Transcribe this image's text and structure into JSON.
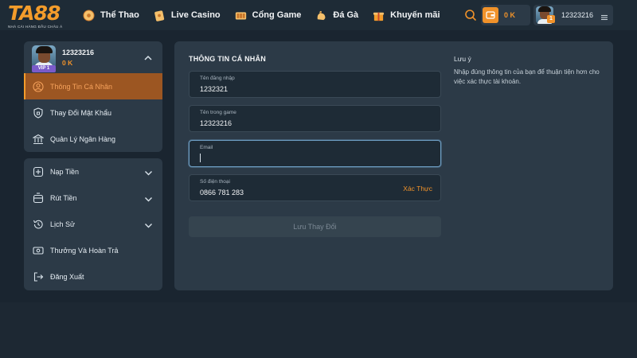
{
  "header": {
    "logo": {
      "text": "TA88",
      "tagline": "NHÀ CÁI HÀNG ĐẦU CHÂU Á"
    },
    "nav": [
      {
        "label": "Thể Thao",
        "icon": "soccer-ball-icon"
      },
      {
        "label": "Live Casino",
        "icon": "playing-card-icon"
      },
      {
        "label": "Cổng Game",
        "icon": "slot-machine-icon"
      },
      {
        "label": "Đá Gà",
        "icon": "rooster-icon"
      },
      {
        "label": "Khuyến mãi",
        "icon": "gift-icon"
      }
    ],
    "balance": "0 K",
    "username": "12323216",
    "user_level": "1"
  },
  "sidebar": {
    "profile": {
      "username": "12323216",
      "balance": "0 K",
      "vip": "VIP 1"
    },
    "account_items": [
      {
        "label": "Thông Tin Cá Nhân",
        "icon": "user-circle-icon",
        "active": true
      },
      {
        "label": "Thay Đổi Mật Khẩu",
        "icon": "shield-lock-icon",
        "active": false
      },
      {
        "label": "Quản Lý Ngân Hàng",
        "icon": "bank-icon",
        "active": false
      }
    ],
    "menu_items": [
      {
        "label": "Nạp Tiền",
        "icon": "deposit-icon",
        "has_submenu": true
      },
      {
        "label": "Rút Tiền",
        "icon": "withdraw-icon",
        "has_submenu": true
      },
      {
        "label": "Lịch Sử",
        "icon": "history-icon",
        "has_submenu": true
      },
      {
        "label": "Thưởng Và Hoàn Trả",
        "icon": "rebate-icon",
        "has_submenu": false
      },
      {
        "label": "Đăng Xuất",
        "icon": "logout-icon",
        "has_submenu": false
      }
    ]
  },
  "main": {
    "title": "THÔNG TIN CÁ NHÂN",
    "fields": {
      "login_name": {
        "label": "Tên đăng nhập",
        "value": "1232321"
      },
      "game_name": {
        "label": "Tên trong game",
        "value": "12323216"
      },
      "email": {
        "label": "Email",
        "value": ""
      },
      "phone": {
        "label": "Số điện thoại",
        "value": "0866 781 283",
        "action": "Xác Thực"
      }
    },
    "save_label": "Lưu Thay Đổi",
    "note": {
      "title": "Lưu ý",
      "text": "Nhập đúng thông tin của bạn để thuận tiện hơn cho việc xác thực tài khoản."
    }
  },
  "colors": {
    "accent": "#f0922a",
    "background": "#1a2530",
    "card": "#2c3a47",
    "active_item": "#9c5622",
    "input_bg": "#1e2b36"
  }
}
